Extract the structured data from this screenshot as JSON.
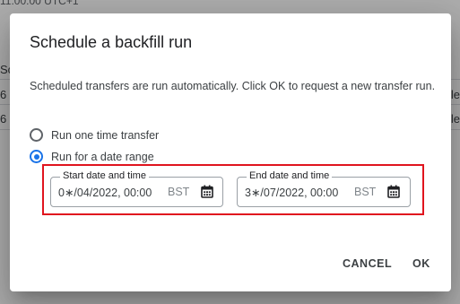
{
  "background": {
    "top_text": "11:00:00 UTC+1",
    "left_rows": [
      "Sc",
      "6",
      "6"
    ],
    "right_rows": [
      "le",
      "le"
    ]
  },
  "dialog": {
    "title": "Schedule a backfill run",
    "description": "Scheduled transfers are run automatically. Click OK to request a new transfer run.",
    "options": [
      {
        "label": "Run one time transfer",
        "checked": false
      },
      {
        "label": "Run for a date range",
        "checked": true
      }
    ],
    "start": {
      "label": "Start date and time",
      "value": "0∗/04/2022, 00:00",
      "tz": "BST"
    },
    "end": {
      "label": "End date and time",
      "value": "3∗/07/2022, 00:00",
      "tz": "BST"
    },
    "cancel_label": "CANCEL",
    "ok_label": "OK"
  },
  "colors": {
    "accent": "#1a73e8",
    "highlight": "#e0141e"
  }
}
